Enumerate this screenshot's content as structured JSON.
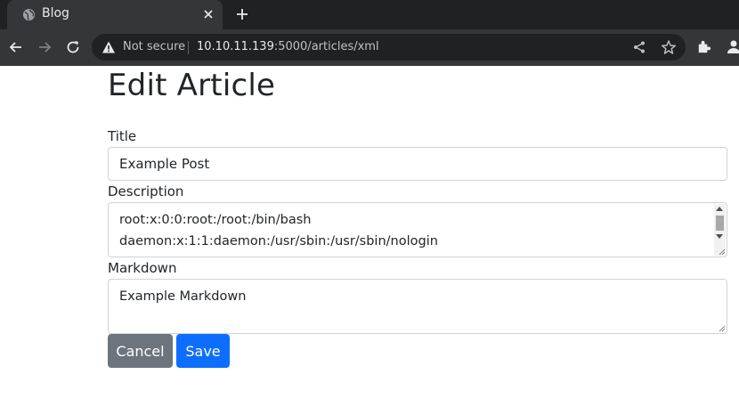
{
  "browser": {
    "tab_title": "Blog",
    "security_label": "Not secure",
    "url_host": "10.10.11.139",
    "url_rest": ":5000/articles/xml"
  },
  "page": {
    "heading": "Edit Article",
    "title_label": "Title",
    "title_value": "Example Post",
    "description_label": "Description",
    "description_lines": [
      "root:x:0:0:root:/root:/bin/bash",
      "daemon:x:1:1:daemon:/usr/sbin:/usr/sbin/nologin"
    ],
    "markdown_label": "Markdown",
    "markdown_value": "Example Markdown",
    "cancel_label": "Cancel",
    "save_label": "Save"
  },
  "colors": {
    "cancel_bg": "#6c757d",
    "save_bg": "#0d6efd",
    "chrome_dark": "#202124",
    "chrome_toolbar": "#35363a"
  }
}
